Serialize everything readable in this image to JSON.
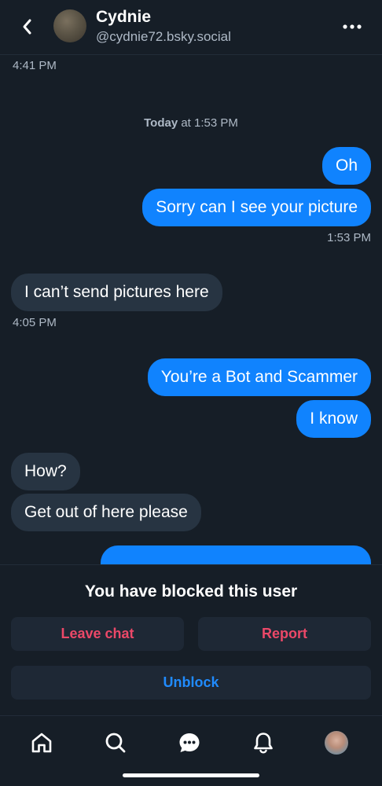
{
  "header": {
    "name": "Cydnie",
    "handle": "@cydnie72.bsky.social"
  },
  "chat": {
    "top_time": "4:41 PM",
    "day_separator": {
      "day": "Today",
      "rest": " at 1:53 PM"
    },
    "messages": [
      {
        "from": "me",
        "text": "Oh"
      },
      {
        "from": "me",
        "text": "Sorry can I see your picture"
      },
      {
        "time": "1:53 PM"
      },
      {
        "from": "them",
        "text": "I can’t send pictures here"
      },
      {
        "time": "4:05 PM"
      },
      {
        "from": "me",
        "text": "You’re a Bot and Scammer"
      },
      {
        "from": "me",
        "text": "I know"
      },
      {
        "from": "them",
        "text": "How?"
      },
      {
        "from": "them",
        "text": "Get out of here please"
      }
    ]
  },
  "blocked": {
    "title": "You have blocked this user",
    "leave_label": "Leave chat",
    "report_label": "Report",
    "unblock_label": "Unblock"
  },
  "tabbar": {
    "icons": [
      "home-icon",
      "search-icon",
      "chat-icon",
      "notifications-icon",
      "profile-avatar"
    ]
  },
  "colors": {
    "background": "#161e27",
    "outgoing_bubble": "#1083fe",
    "incoming_bubble": "#273442",
    "danger_text": "#ec4868",
    "accent_text": "#208bfe",
    "muted_text": "#aeb9c6"
  }
}
